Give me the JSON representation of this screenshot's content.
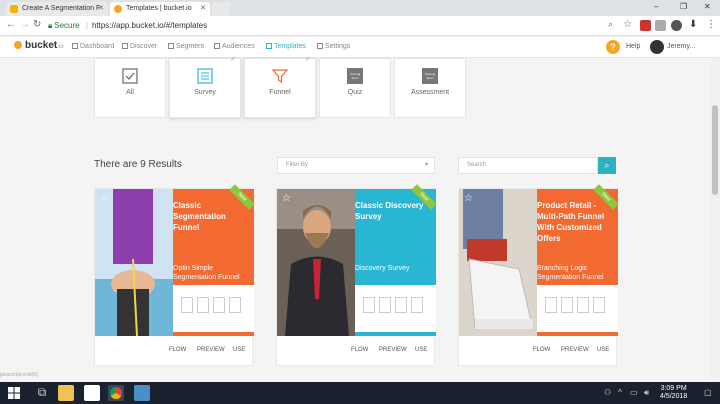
{
  "browser": {
    "tabs": [
      {
        "label": "Create A Segmentation F",
        "active": false
      },
      {
        "label": "Templates | bucket.io",
        "active": true
      }
    ],
    "secure_label": "Secure",
    "url": "https://app.bucket.io/#/templates"
  },
  "appnav": {
    "logo": "bucket",
    "logo_sub": ".io",
    "items": [
      "Dashboard",
      "Discover",
      "Segment",
      "Audiences",
      "Templates",
      "Settings"
    ],
    "active_item": "Templates",
    "help_label": "Help",
    "user_name": "Jeremy..."
  },
  "types": [
    {
      "label": "All"
    },
    {
      "label": "Survey"
    },
    {
      "label": "Funnel"
    },
    {
      "label": "Quiz",
      "icon_text": "Coming Soon"
    },
    {
      "label": "Assessment",
      "icon_text": "Coming Soon"
    }
  ],
  "results_text": "There are 9 Results",
  "filter": {
    "placeholder": "Filter By"
  },
  "search": {
    "placeholder": "Search"
  },
  "templates": [
    {
      "title": "Classic Segmentation Funnel",
      "subtitle": "Optin Simple Segmentation Funnel",
      "badge": "New",
      "color": "#f26a32"
    },
    {
      "title": "Classic Discovery Survey",
      "subtitle": "Discovery Survey",
      "badge": "New",
      "color": "#29b6d3"
    },
    {
      "title": "Product Retail - Multi-Path Funnel With Customized Offers",
      "subtitle": "Branching Logic Segmentation Funnel",
      "badge": "New",
      "color": "#f26a32"
    }
  ],
  "card_actions": [
    "FLOW",
    "PREVIEW",
    "USE"
  ],
  "statusbar_text": "javascript:void(0)",
  "taskbar": {
    "time": "3:09 PM",
    "date": "4/5/2018"
  }
}
